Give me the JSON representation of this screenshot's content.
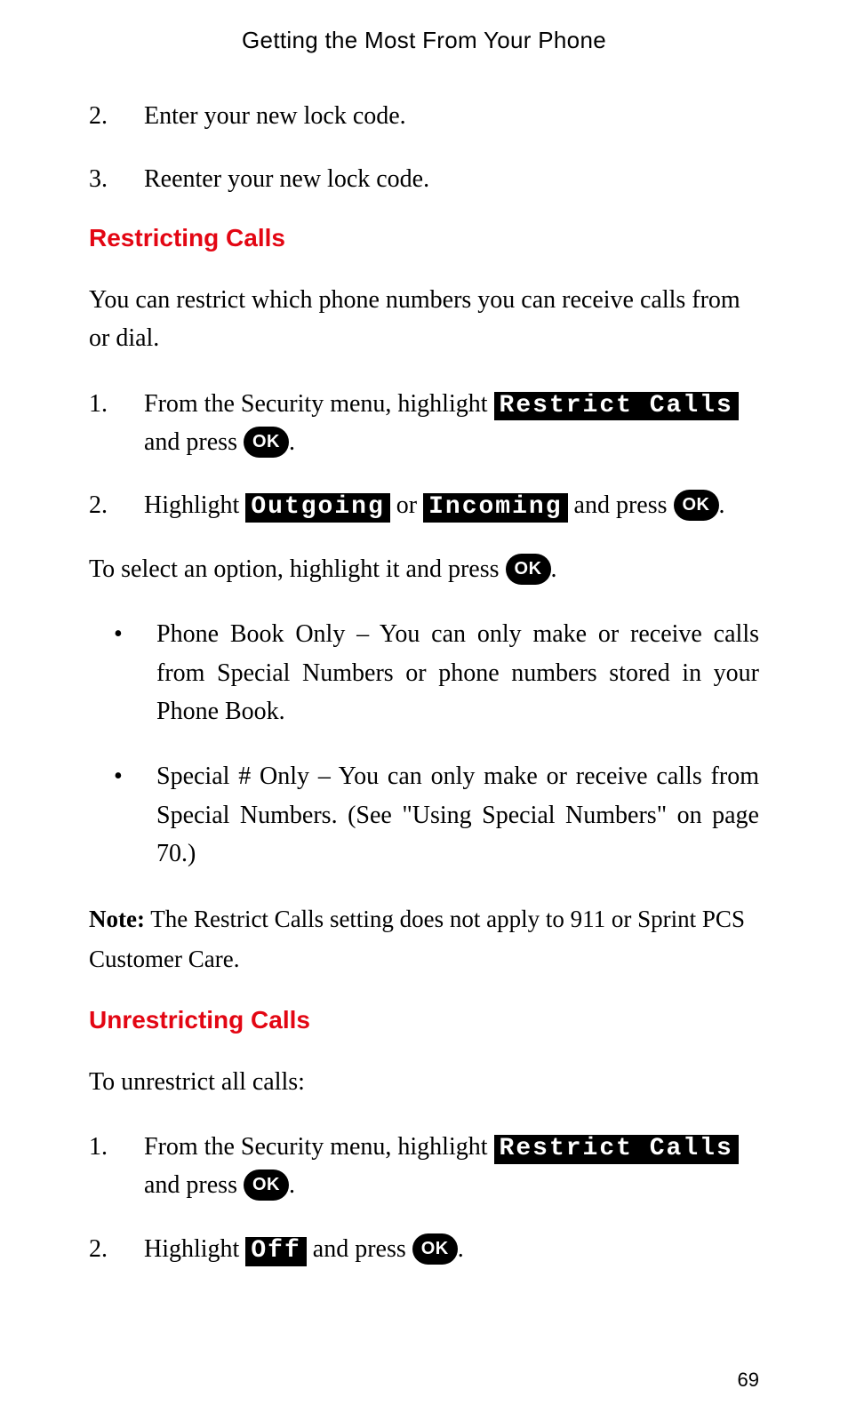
{
  "header": "Getting the Most From Your Phone",
  "topSteps": [
    {
      "num": "2.",
      "text": "Enter your new lock code."
    },
    {
      "num": "3.",
      "text": "Reenter your new lock code."
    }
  ],
  "restricting": {
    "heading": "Restricting Calls",
    "intro": "You can restrict which phone numbers you can receive calls from or dial.",
    "steps": {
      "s1": {
        "num": "1.",
        "pre": "From the Security menu, highlight ",
        "menu": "Restrict Calls",
        "mid": " and press ",
        "ok": "OK",
        "post": "."
      },
      "s2": {
        "num": "2.",
        "pre": "Highlight ",
        "menu1": "Outgoing",
        "or": " or ",
        "menu2": "Incoming",
        "mid": " and press ",
        "ok": "OK",
        "post": "."
      }
    },
    "selectOption": {
      "pre": "To select an option, highlight it and press ",
      "ok": "OK",
      "post": "."
    },
    "bullets": [
      "Phone Book Only – You can only make or receive calls from Special Numbers or phone numbers stored in your Phone Book.",
      "Special # Only – You can only make or receive calls from Special Numbers. (See \"Using Special Numbers\" on page 70.)"
    ],
    "note": {
      "label": "Note:",
      "text": " The Restrict Calls setting does not apply to 911 or Sprint PCS Customer Care."
    }
  },
  "unrestricting": {
    "heading": "Unrestricting Calls",
    "intro": "To unrestrict all calls:",
    "steps": {
      "s1": {
        "num": "1.",
        "pre": "From the Security menu, highlight ",
        "menu": "Restrict Calls",
        "mid": " and press ",
        "ok": "OK",
        "post": "."
      },
      "s2": {
        "num": "2.",
        "pre": "Highlight ",
        "menu": "Off",
        "mid": " and press ",
        "ok": "OK",
        "post": "."
      }
    }
  },
  "pageNumber": "69",
  "bullet": "•"
}
